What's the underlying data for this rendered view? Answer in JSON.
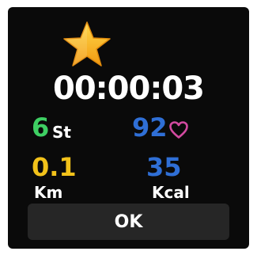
{
  "timer": {
    "elapsed": "00:00:03"
  },
  "steps": {
    "value": "6",
    "unit": "St"
  },
  "heart_rate": {
    "value": "92",
    "icon": "heart-icon"
  },
  "distance": {
    "value": "0.1",
    "unit": "Km"
  },
  "calories": {
    "value": "35",
    "unit": "Kcal"
  },
  "ok_button": {
    "label": "OK"
  },
  "icons": {
    "achievement": "star-icon"
  },
  "colors": {
    "steps": "#3ecf63",
    "heart_rate": "#2f6fd6",
    "distance": "#f2c21a",
    "calories": "#2f6fd6",
    "heart": "#d24aa0",
    "star": "#f6b31c"
  }
}
